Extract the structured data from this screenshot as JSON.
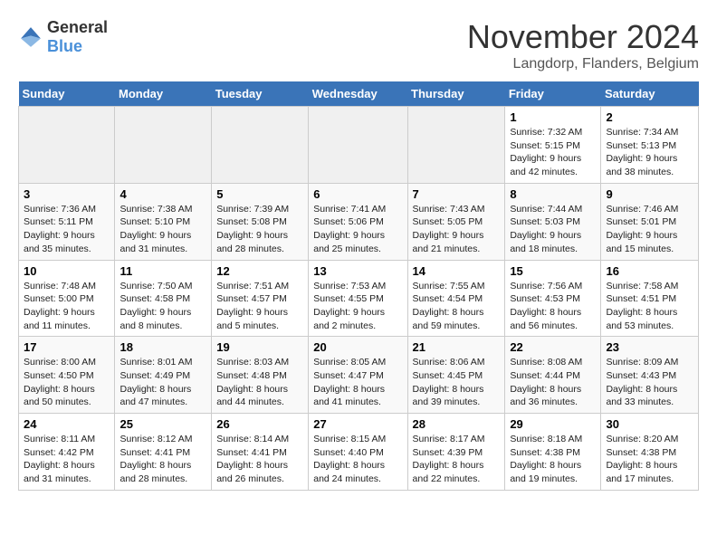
{
  "header": {
    "logo_general": "General",
    "logo_blue": "Blue",
    "title": "November 2024",
    "location": "Langdorp, Flanders, Belgium"
  },
  "weekdays": [
    "Sunday",
    "Monday",
    "Tuesday",
    "Wednesday",
    "Thursday",
    "Friday",
    "Saturday"
  ],
  "weeks": [
    [
      {
        "day": "",
        "info": ""
      },
      {
        "day": "",
        "info": ""
      },
      {
        "day": "",
        "info": ""
      },
      {
        "day": "",
        "info": ""
      },
      {
        "day": "",
        "info": ""
      },
      {
        "day": "1",
        "info": "Sunrise: 7:32 AM\nSunset: 5:15 PM\nDaylight: 9 hours and 42 minutes."
      },
      {
        "day": "2",
        "info": "Sunrise: 7:34 AM\nSunset: 5:13 PM\nDaylight: 9 hours and 38 minutes."
      }
    ],
    [
      {
        "day": "3",
        "info": "Sunrise: 7:36 AM\nSunset: 5:11 PM\nDaylight: 9 hours and 35 minutes."
      },
      {
        "day": "4",
        "info": "Sunrise: 7:38 AM\nSunset: 5:10 PM\nDaylight: 9 hours and 31 minutes."
      },
      {
        "day": "5",
        "info": "Sunrise: 7:39 AM\nSunset: 5:08 PM\nDaylight: 9 hours and 28 minutes."
      },
      {
        "day": "6",
        "info": "Sunrise: 7:41 AM\nSunset: 5:06 PM\nDaylight: 9 hours and 25 minutes."
      },
      {
        "day": "7",
        "info": "Sunrise: 7:43 AM\nSunset: 5:05 PM\nDaylight: 9 hours and 21 minutes."
      },
      {
        "day": "8",
        "info": "Sunrise: 7:44 AM\nSunset: 5:03 PM\nDaylight: 9 hours and 18 minutes."
      },
      {
        "day": "9",
        "info": "Sunrise: 7:46 AM\nSunset: 5:01 PM\nDaylight: 9 hours and 15 minutes."
      }
    ],
    [
      {
        "day": "10",
        "info": "Sunrise: 7:48 AM\nSunset: 5:00 PM\nDaylight: 9 hours and 11 minutes."
      },
      {
        "day": "11",
        "info": "Sunrise: 7:50 AM\nSunset: 4:58 PM\nDaylight: 9 hours and 8 minutes."
      },
      {
        "day": "12",
        "info": "Sunrise: 7:51 AM\nSunset: 4:57 PM\nDaylight: 9 hours and 5 minutes."
      },
      {
        "day": "13",
        "info": "Sunrise: 7:53 AM\nSunset: 4:55 PM\nDaylight: 9 hours and 2 minutes."
      },
      {
        "day": "14",
        "info": "Sunrise: 7:55 AM\nSunset: 4:54 PM\nDaylight: 8 hours and 59 minutes."
      },
      {
        "day": "15",
        "info": "Sunrise: 7:56 AM\nSunset: 4:53 PM\nDaylight: 8 hours and 56 minutes."
      },
      {
        "day": "16",
        "info": "Sunrise: 7:58 AM\nSunset: 4:51 PM\nDaylight: 8 hours and 53 minutes."
      }
    ],
    [
      {
        "day": "17",
        "info": "Sunrise: 8:00 AM\nSunset: 4:50 PM\nDaylight: 8 hours and 50 minutes."
      },
      {
        "day": "18",
        "info": "Sunrise: 8:01 AM\nSunset: 4:49 PM\nDaylight: 8 hours and 47 minutes."
      },
      {
        "day": "19",
        "info": "Sunrise: 8:03 AM\nSunset: 4:48 PM\nDaylight: 8 hours and 44 minutes."
      },
      {
        "day": "20",
        "info": "Sunrise: 8:05 AM\nSunset: 4:47 PM\nDaylight: 8 hours and 41 minutes."
      },
      {
        "day": "21",
        "info": "Sunrise: 8:06 AM\nSunset: 4:45 PM\nDaylight: 8 hours and 39 minutes."
      },
      {
        "day": "22",
        "info": "Sunrise: 8:08 AM\nSunset: 4:44 PM\nDaylight: 8 hours and 36 minutes."
      },
      {
        "day": "23",
        "info": "Sunrise: 8:09 AM\nSunset: 4:43 PM\nDaylight: 8 hours and 33 minutes."
      }
    ],
    [
      {
        "day": "24",
        "info": "Sunrise: 8:11 AM\nSunset: 4:42 PM\nDaylight: 8 hours and 31 minutes."
      },
      {
        "day": "25",
        "info": "Sunrise: 8:12 AM\nSunset: 4:41 PM\nDaylight: 8 hours and 28 minutes."
      },
      {
        "day": "26",
        "info": "Sunrise: 8:14 AM\nSunset: 4:41 PM\nDaylight: 8 hours and 26 minutes."
      },
      {
        "day": "27",
        "info": "Sunrise: 8:15 AM\nSunset: 4:40 PM\nDaylight: 8 hours and 24 minutes."
      },
      {
        "day": "28",
        "info": "Sunrise: 8:17 AM\nSunset: 4:39 PM\nDaylight: 8 hours and 22 minutes."
      },
      {
        "day": "29",
        "info": "Sunrise: 8:18 AM\nSunset: 4:38 PM\nDaylight: 8 hours and 19 minutes."
      },
      {
        "day": "30",
        "info": "Sunrise: 8:20 AM\nSunset: 4:38 PM\nDaylight: 8 hours and 17 minutes."
      }
    ]
  ]
}
